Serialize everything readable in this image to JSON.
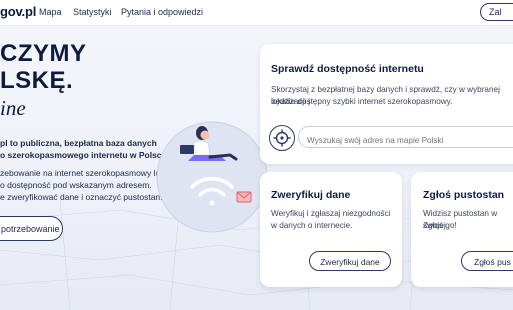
{
  "header": {
    "logo": "gov.pl",
    "nav": [
      "Mapa",
      "Statystyki",
      "Pytania i odpowiedzi"
    ],
    "login_label": "Zal"
  },
  "hero": {
    "title_line1": "CZYMY",
    "title_line2": "LSKĘ.",
    "title_italic": "ine",
    "desc_bold_line1": "pl to publiczna, bezpłatna baza danych",
    "desc_bold_line2": "o szerokopasmowego internetu w Polsce.",
    "desc_line1": "zebowanie na internet szerokopasmowy lub",
    "desc_line2": "o dostępność pod wskazanym adresem.",
    "desc_line3": "e zweryfikować dane i oznaczyć pustostan.",
    "button_label": "potrzebowanie"
  },
  "check_card": {
    "title": "Sprawdź dostępność internetu",
    "text_line1": "Skorzystaj z bezpłatnej bazy danych i sprawdź, czy w wybranej lokalizacji j",
    "text_line2": "będzie dostępny szybki internet szerokopasmowy.",
    "search_placeholder": "Wyszukaj swój adres na mapie Polski"
  },
  "verify_card": {
    "title": "Zweryfikuj dane",
    "text_line1": "Weryfikuj i zgłaszaj niezgodności",
    "text_line2": "w danych o internecie.",
    "button_label": "Zweryfikuj dane"
  },
  "gap_card": {
    "title": "Zgłoś pustostan",
    "text_line1": "Widzisz pustostan w swojej",
    "text_line2": "Zgłoś go!",
    "button_label": "Zgłoś pus"
  },
  "colors": {
    "navy": "#0d1b3e",
    "accent_purple": "#7b6cf0",
    "envelope_red": "#e0606a"
  }
}
